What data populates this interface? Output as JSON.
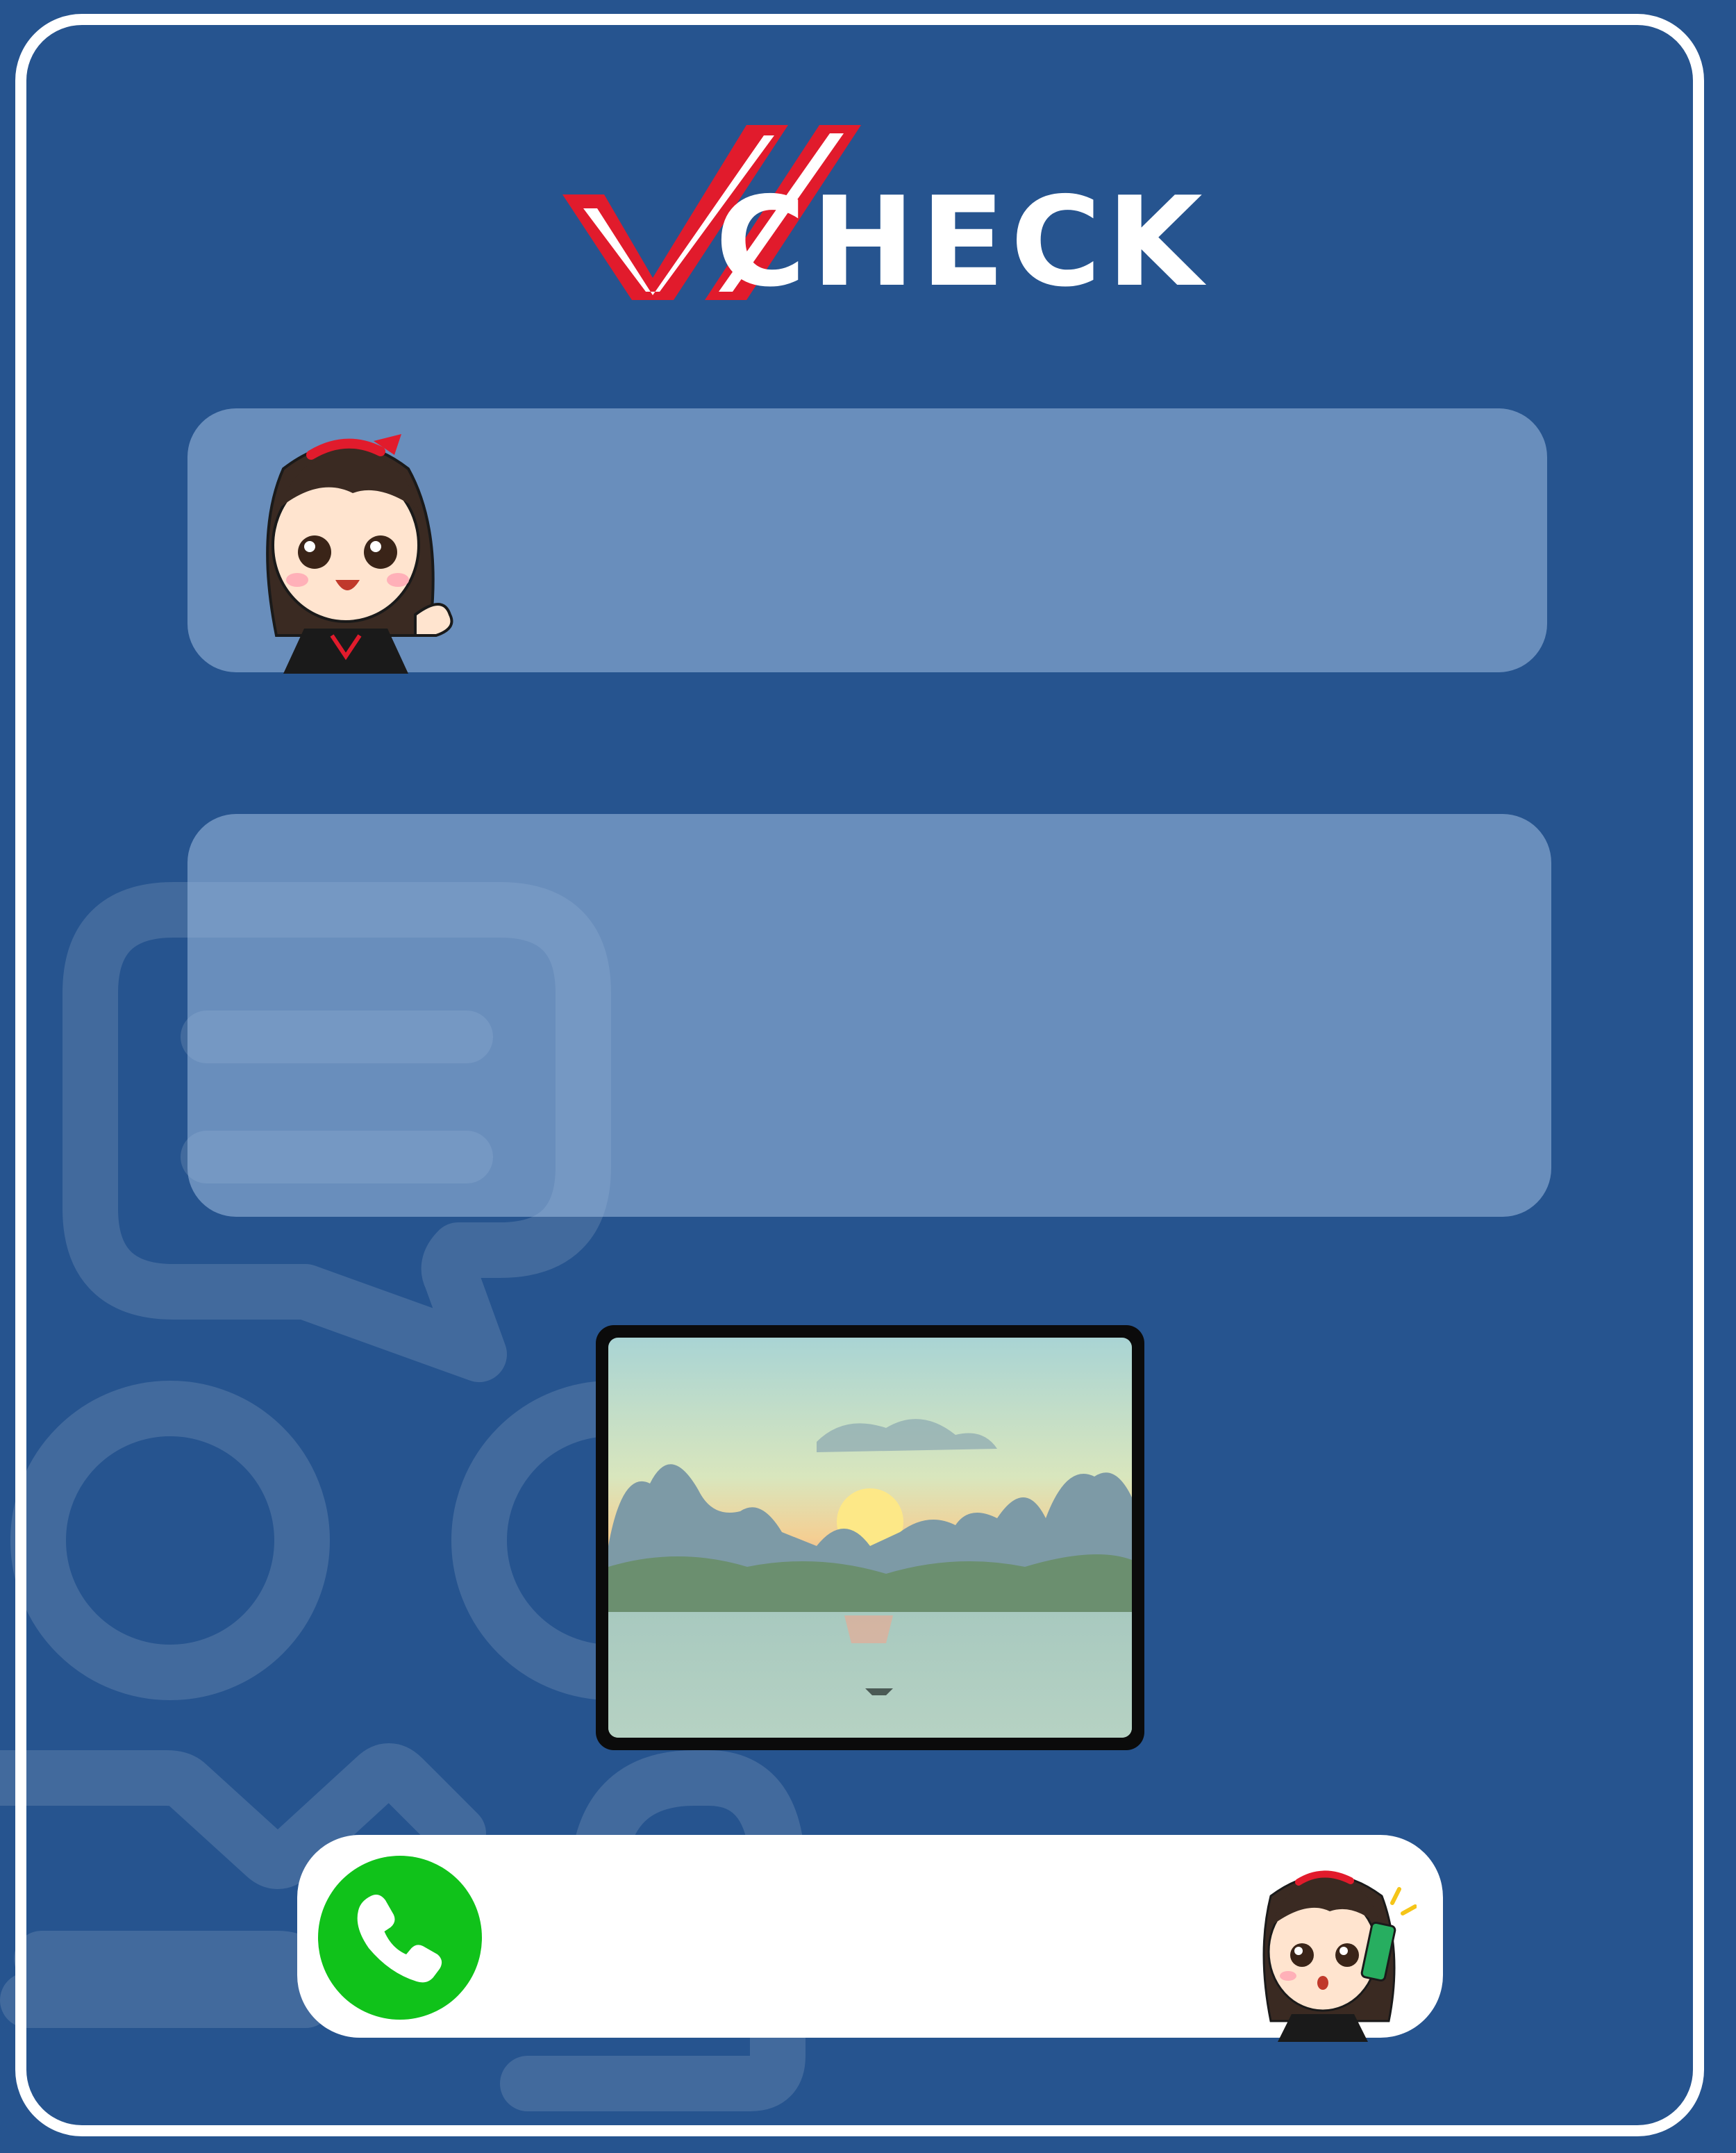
{
  "brand": {
    "name": "CHECK",
    "colors": {
      "primary_blue": "#26548f",
      "check_red": "#e11b2c",
      "white": "#ffffff",
      "call_green": "#10c21a"
    }
  },
  "icons": {
    "logo_mark": "checkmark-logo-icon",
    "call": "phone-icon",
    "bg_chat": "chat-bubble-icon"
  },
  "media": {
    "photo": "sunset-landscape"
  }
}
